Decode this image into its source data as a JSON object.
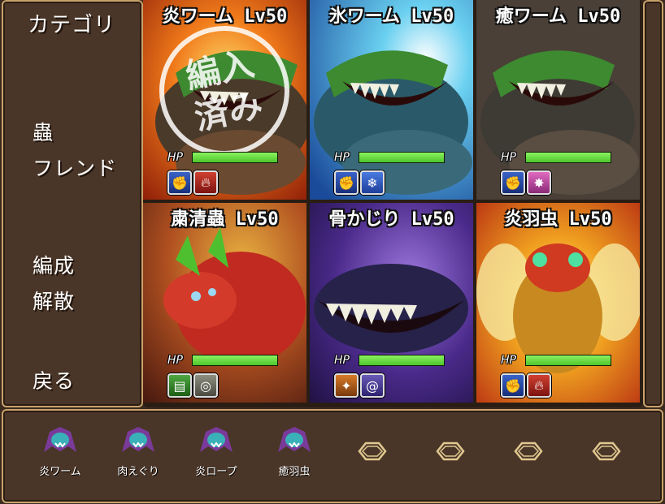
{
  "menu": {
    "category": "カテゴリ",
    "items": [
      "蟲",
      "フレンド",
      "編成",
      "解散",
      "戻る"
    ]
  },
  "stamp": [
    "編入",
    "済み"
  ],
  "cards": [
    {
      "name": "炎ワーム",
      "level": "Lv50",
      "hp_label": "HP",
      "hp_fraction": 1.0,
      "skills": [
        "sk-blue:fist-icon",
        "sk-red:flame-icon"
      ],
      "stamped": true
    },
    {
      "name": "氷ワーム",
      "level": "Lv50",
      "hp_label": "HP",
      "hp_fraction": 1.0,
      "skills": [
        "sk-blue:fist-icon",
        "sk-ice:snowflake-icon"
      ],
      "stamped": false
    },
    {
      "name": "癒ワーム",
      "level": "Lv50",
      "hp_label": "HP",
      "hp_fraction": 1.0,
      "skills": [
        "sk-blue:fist-icon",
        "sk-pink:sparkle-icon"
      ],
      "stamped": false
    },
    {
      "name": "粛清蟲",
      "level": "Lv50",
      "hp_label": "HP",
      "hp_fraction": 1.0,
      "skills": [
        "sk-green:book-icon",
        "sk-gray:target-icon"
      ],
      "stamped": false
    },
    {
      "name": "骨かじり",
      "level": "Lv50",
      "hp_label": "HP",
      "hp_fraction": 1.0,
      "skills": [
        "sk-orange:burst-icon",
        "sk-purple:swirl-icon"
      ],
      "stamped": false
    },
    {
      "name": "炎羽虫",
      "level": "Lv50",
      "hp_label": "HP",
      "hp_fraction": 1.0,
      "skills": [
        "sk-blue:fist-icon",
        "sk-red:flame-icon"
      ],
      "stamped": false
    }
  ],
  "party": {
    "members": [
      "炎ワーム",
      "肉えぐり",
      "炎ロープ",
      "癒羽虫"
    ],
    "empty_slots": 4
  },
  "colors": {
    "panel_bg": "#4a3628",
    "panel_border": "#c8a26b",
    "hp_green": "#4fc52c"
  }
}
